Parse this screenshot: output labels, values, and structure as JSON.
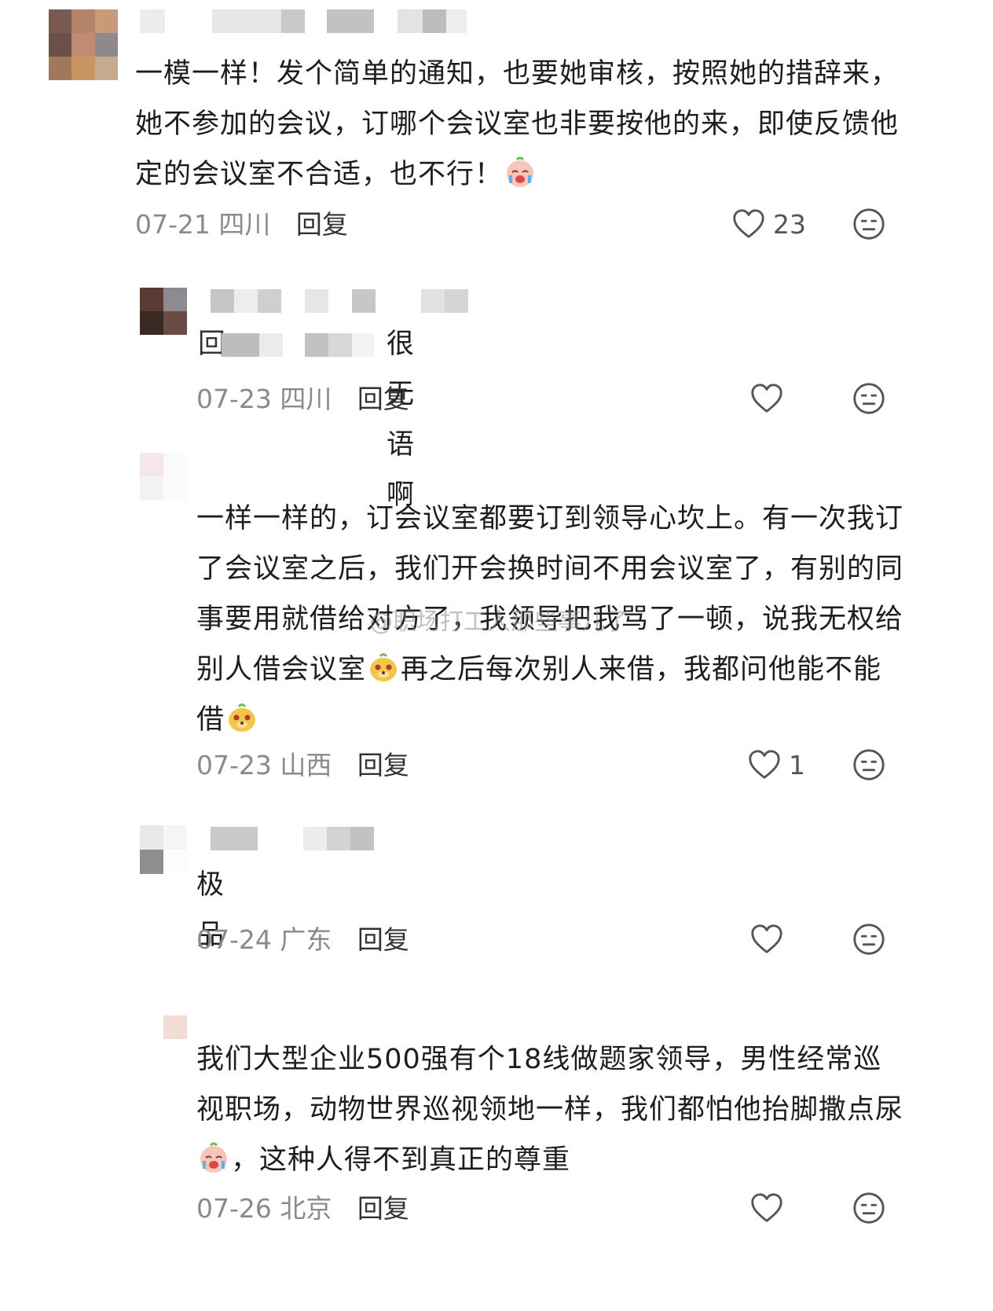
{
  "comments": [
    {
      "text": "一模一样！发个简单的通知，也要她审核，按照她的措辞来，她不参加的会议，订哪个会议室也非要按他的来，即使反馈他定的会议室不合适，也不行！",
      "emoji_after": "crying-face-emoji",
      "date": "07-21",
      "location": "四川",
      "reply_label": "回复",
      "like_count": "23"
    },
    {
      "reply_prefix": "回",
      "text": "很无语啊",
      "date": "07-23",
      "location": "四川",
      "reply_label": "回复",
      "like_count": ""
    },
    {
      "text_part1": "一样一样的，订会议室都要订到领导心坎上。有一次我订了会议室之后，我们开会换时间不用会议室了，有别的同事要用就借给对方了，我领导把我骂了一顿，说我无权给别人借会议室",
      "text_part2": "再之后每次别人来借，我都问他能不能借",
      "date": "07-23",
      "location": "山西",
      "reply_label": "回复",
      "like_count": "1"
    },
    {
      "text": "极品",
      "date": "07-24",
      "location": "广东",
      "reply_label": "回复",
      "like_count": ""
    },
    {
      "text_part1": "我们大型企业500强有个18线做题家领导，男性经常巡视职场，动物世界巡视领地一样，我们都怕他抬脚撒点尿",
      "text_part2": "，这种人得不到真正的尊重",
      "date": "07-26",
      "location": "北京",
      "reply_label": "回复",
      "like_count": ""
    }
  ],
  "watermark": "@职场打工人那些事儿了",
  "icons": {
    "like": "heart-outline-icon",
    "dislike": "unhappy-face-icon"
  }
}
